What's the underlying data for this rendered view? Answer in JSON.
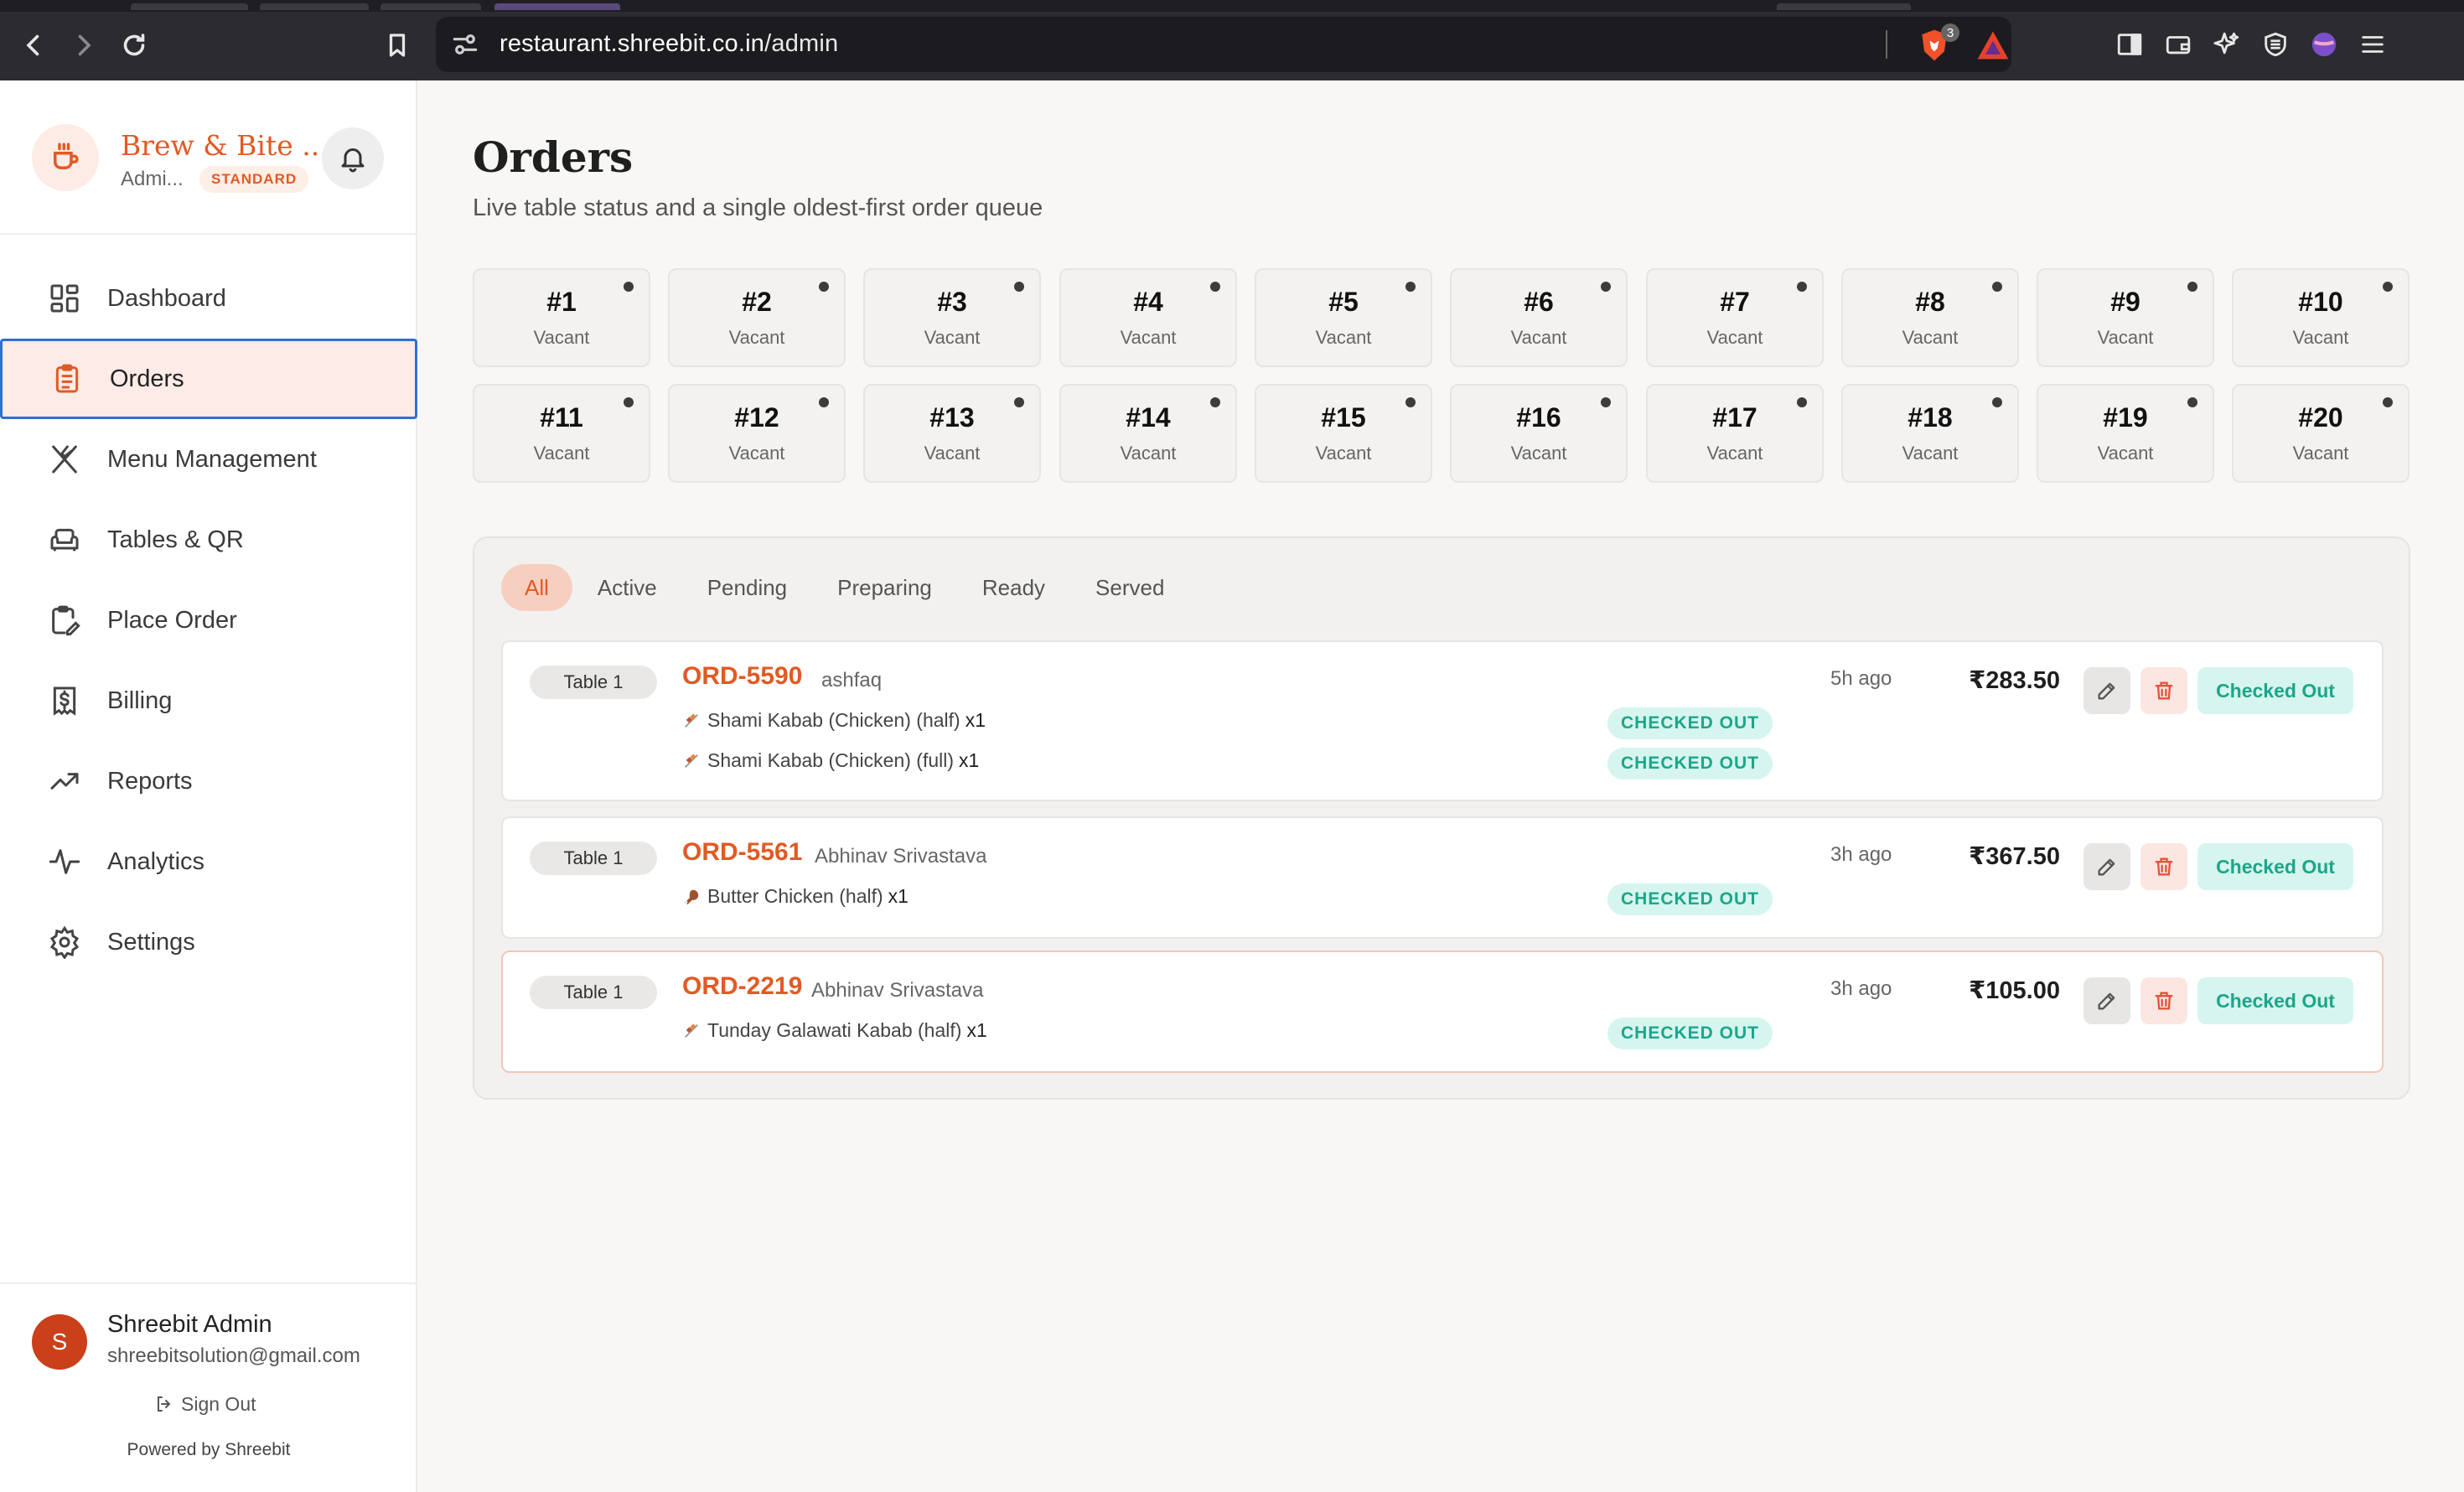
{
  "browser": {
    "url_host": "restaurant.shreebit.co.in",
    "url_path": "/admin",
    "shield_count": "3"
  },
  "brand": {
    "name": "Brew & Bite ...",
    "role": "Admi...",
    "plan": "STANDARD"
  },
  "sidebar": {
    "items": [
      {
        "label": "Dashboard",
        "icon": "dashboard-icon"
      },
      {
        "label": "Orders",
        "icon": "clipboard-icon"
      },
      {
        "label": "Menu Management",
        "icon": "utensils-icon"
      },
      {
        "label": "Tables & QR",
        "icon": "sofa-icon"
      },
      {
        "label": "Place Order",
        "icon": "clipboard-edit-icon"
      },
      {
        "label": "Billing",
        "icon": "receipt-icon"
      },
      {
        "label": "Reports",
        "icon": "trending-up-icon"
      },
      {
        "label": "Analytics",
        "icon": "activity-icon"
      },
      {
        "label": "Settings",
        "icon": "gear-icon"
      }
    ],
    "active": "Orders"
  },
  "user": {
    "initial": "S",
    "name": "Shreebit Admin",
    "email": "shreebitsolution@gmail.com",
    "sign_out": "Sign Out",
    "powered_by": "Powered by Shreebit"
  },
  "page": {
    "title": "Orders",
    "subtitle": "Live table status and a single oldest-first order queue"
  },
  "tables": [
    {
      "num": "#1",
      "status": "Vacant"
    },
    {
      "num": "#2",
      "status": "Vacant"
    },
    {
      "num": "#3",
      "status": "Vacant"
    },
    {
      "num": "#4",
      "status": "Vacant"
    },
    {
      "num": "#5",
      "status": "Vacant"
    },
    {
      "num": "#6",
      "status": "Vacant"
    },
    {
      "num": "#7",
      "status": "Vacant"
    },
    {
      "num": "#8",
      "status": "Vacant"
    },
    {
      "num": "#9",
      "status": "Vacant"
    },
    {
      "num": "#10",
      "status": "Vacant"
    },
    {
      "num": "#11",
      "status": "Vacant"
    },
    {
      "num": "#12",
      "status": "Vacant"
    },
    {
      "num": "#13",
      "status": "Vacant"
    },
    {
      "num": "#14",
      "status": "Vacant"
    },
    {
      "num": "#15",
      "status": "Vacant"
    },
    {
      "num": "#16",
      "status": "Vacant"
    },
    {
      "num": "#17",
      "status": "Vacant"
    },
    {
      "num": "#18",
      "status": "Vacant"
    },
    {
      "num": "#19",
      "status": "Vacant"
    },
    {
      "num": "#20",
      "status": "Vacant"
    }
  ],
  "filters": [
    "All",
    "Active",
    "Pending",
    "Preparing",
    "Ready",
    "Served"
  ],
  "active_filter": "All",
  "orders": [
    {
      "table": "Table 1",
      "id": "ORD-5590",
      "customer": "ashfaq",
      "ago": "5h ago",
      "amount": "₹283.50",
      "status": "Checked Out",
      "items": [
        {
          "name": "Shami Kabab (Chicken) (half)",
          "qty": "x1",
          "status": "CHECKED OUT",
          "icon": "kebab-icon"
        },
        {
          "name": "Shami Kabab (Chicken) (full)",
          "qty": "x1",
          "status": "CHECKED OUT",
          "icon": "kebab-icon"
        }
      ]
    },
    {
      "table": "Table 1",
      "id": "ORD-5561",
      "customer": "Abhinav Srivastava",
      "ago": "3h ago",
      "amount": "₹367.50",
      "status": "Checked Out",
      "items": [
        {
          "name": "Butter Chicken (half)",
          "qty": "x1",
          "status": "CHECKED OUT",
          "icon": "drumstick-icon"
        }
      ]
    },
    {
      "table": "Table 1",
      "id": "ORD-2219",
      "customer": "Abhinav Srivastava",
      "ago": "3h ago",
      "amount": "₹105.00",
      "status": "Checked Out",
      "items": [
        {
          "name": "Tunday Galawati Kabab (half)",
          "qty": "x1",
          "status": "CHECKED OUT",
          "icon": "kebab-icon"
        }
      ]
    }
  ],
  "colors": {
    "accent": "#e15a24",
    "active_nav_bg": "#fcebe6",
    "active_nav_border": "#2f6fd6",
    "checked_out_bg": "#d6f5ee",
    "checked_out_text": "#1ba68a"
  }
}
